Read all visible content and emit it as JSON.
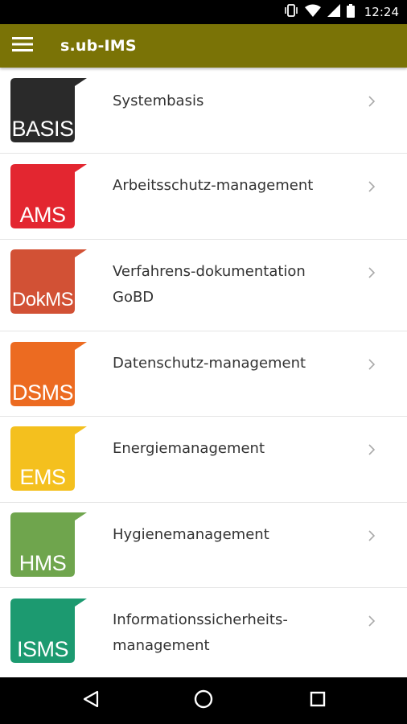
{
  "status_bar": {
    "time": "12:24",
    "icons": [
      "vibrate-icon",
      "wifi-icon",
      "signal-icon",
      "battery-icon"
    ]
  },
  "app_bar": {
    "title": "s.ub-IMS",
    "menu_icon": "hamburger-menu-icon"
  },
  "items": [
    {
      "logo": "BASIS",
      "label": "Systembasis",
      "color": "#2a2a2a"
    },
    {
      "logo": "AMS",
      "label": "Arbeitsschutz-management",
      "color": "#e32630"
    },
    {
      "logo": "DokMS",
      "label": "Verfahrens-dokumentation GoBD",
      "color": "#d25135"
    },
    {
      "logo": "DSMS",
      "label": "Datenschutz-management",
      "color": "#ec6b21"
    },
    {
      "logo": "EMS",
      "label": "Energiemanagement",
      "color": "#f4c01e"
    },
    {
      "logo": "HMS",
      "label": "Hygienemanagement",
      "color": "#6fa54d"
    },
    {
      "logo": "ISMS",
      "label": "Informationssicherheits-management",
      "color": "#1c9a70"
    }
  ],
  "nav_bar": {
    "buttons": [
      "back-icon",
      "home-icon",
      "recents-icon"
    ]
  },
  "colors": {
    "app_bar": "#7a7306",
    "status_bar": "#000000",
    "text": "#333333",
    "divider": "#e4e4e4"
  }
}
